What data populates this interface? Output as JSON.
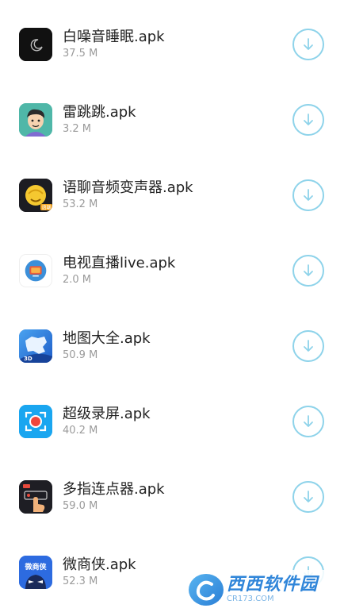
{
  "apps": [
    {
      "name": "白噪音睡眠.apk",
      "size": "37.5 M",
      "icon": "white-noise-sleep-icon"
    },
    {
      "name": "雷跳跳.apk",
      "size": "3.2 M",
      "icon": "cartoon-boy-icon"
    },
    {
      "name": "语聊音频变声器.apk",
      "size": "53.2 M",
      "icon": "voice-changer-icon"
    },
    {
      "name": "电视直播live.apk",
      "size": "2.0 M",
      "icon": "tv-live-icon"
    },
    {
      "name": "地图大全.apk",
      "size": "50.9 M",
      "icon": "map-icon"
    },
    {
      "name": "超级录屏.apk",
      "size": "40.2 M",
      "icon": "screen-record-icon"
    },
    {
      "name": "多指连点器.apk",
      "size": "59.0 M",
      "icon": "auto-clicker-icon"
    },
    {
      "name": "微商侠.apk",
      "size": "52.3 M",
      "icon": "weishangxia-icon"
    }
  ],
  "icon_text": {
    "voice_badge": "语聊",
    "map_badge": "3D",
    "weishangxia": "微商侠"
  },
  "watermark": {
    "brand": "西西软件园",
    "url": "CR173.COM"
  },
  "colors": {
    "download_ring": "#8ed3ea",
    "name_text": "#222222",
    "size_text": "#9a9a9a"
  }
}
